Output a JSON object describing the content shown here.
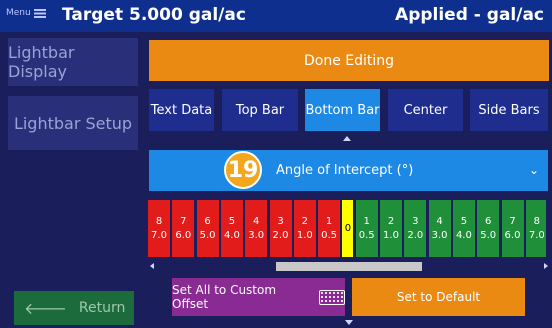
{
  "header": {
    "menu_label": "Menu",
    "title_left": "Target 5.000 gal/ac",
    "title_right": "Applied - gal/ac"
  },
  "sidebar": {
    "items": [
      {
        "label": "Lightbar Display"
      },
      {
        "label": "Lightbar Setup"
      }
    ],
    "return_label": "Return"
  },
  "main": {
    "done_label": "Done Editing",
    "tabs": [
      {
        "label": "Text Data",
        "active": false
      },
      {
        "label": "Top Bar",
        "active": false
      },
      {
        "label": "Bottom Bar",
        "active": true
      },
      {
        "label": "Center",
        "active": false
      },
      {
        "label": "Side Bars",
        "active": false
      }
    ],
    "dropdown": {
      "badge": "19",
      "label": "Angle of Intercept (°)"
    },
    "segments": [
      {
        "num": "8",
        "val": "7.0",
        "color": "red"
      },
      {
        "num": "7",
        "val": "6.0",
        "color": "red"
      },
      {
        "num": "6",
        "val": "5.0",
        "color": "red"
      },
      {
        "num": "5",
        "val": "4.0",
        "color": "red"
      },
      {
        "num": "4",
        "val": "3.0",
        "color": "red"
      },
      {
        "num": "3",
        "val": "2.0",
        "color": "red"
      },
      {
        "num": "2",
        "val": "1.0",
        "color": "red"
      },
      {
        "num": "1",
        "val": "0.5",
        "color": "red"
      },
      {
        "num": "",
        "val": "0",
        "color": "yellow"
      },
      {
        "num": "1",
        "val": "0.5",
        "color": "green"
      },
      {
        "num": "2",
        "val": "1.0",
        "color": "green"
      },
      {
        "num": "3",
        "val": "2.0",
        "color": "green"
      },
      {
        "num": "4",
        "val": "3.0",
        "color": "green"
      },
      {
        "num": "5",
        "val": "4.0",
        "color": "green"
      },
      {
        "num": "6",
        "val": "5.0",
        "color": "green"
      },
      {
        "num": "7",
        "val": "6.0",
        "color": "green"
      },
      {
        "num": "8",
        "val": "7.0",
        "color": "green"
      }
    ],
    "custom_offset_label": "Set All to Custom Offset",
    "default_label": "Set to Default"
  },
  "colors": {
    "background": "#1a1f5c",
    "header": "#0f2f8f",
    "orange": "#ea8a12",
    "active_tab": "#1e88e5",
    "purple": "#8a2a93",
    "return_green": "#1c6b3c"
  }
}
